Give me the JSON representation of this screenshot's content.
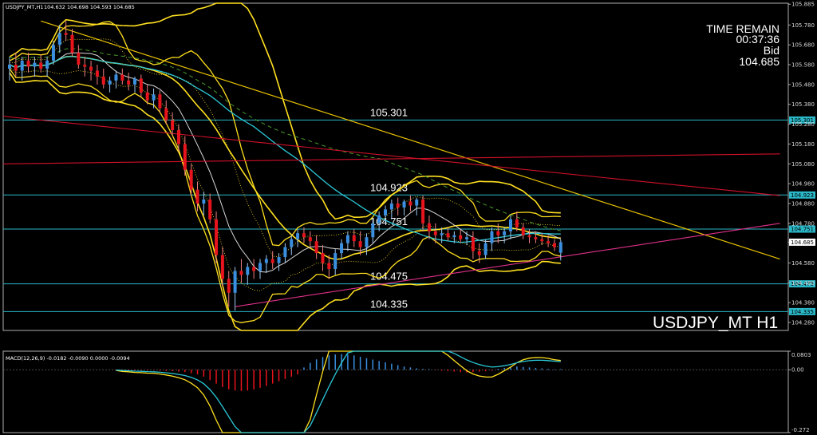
{
  "header": {
    "symbol_info": "USDJPY_MT,H1",
    "ohlc": "104.632 104.698 104.593 104.685"
  },
  "info_panel": {
    "time_remain_label": "TIME REMAIN",
    "time_remain": "00:37:36",
    "bid_label": "Bid",
    "bid": "104.685"
  },
  "symbol_watermark": "USDJPY_MT H1",
  "macd_header": "MACD(12,26,9) -0.0182 -0.0090 0.0000 -0.0094",
  "colors": {
    "background": "#000000",
    "bull": "#3b8fe0",
    "bear": "#e8141d",
    "bollinger": "#ffe020",
    "trendline_yellow": "#e8c200",
    "trendline_red": "#d0102a",
    "trendline_magenta": "#e0308a",
    "ma_cyan": "#2ac8d8",
    "ma_green_dashed": "#4a9a2a",
    "ma_white": "#d8d8d8",
    "level_line": "#2ab8c8"
  },
  "chart_data": [
    {
      "type": "candlestick",
      "title": "USDJPY_MT,H1",
      "y_axis_ticks": [
        "105.885",
        "105.780",
        "105.680",
        "105.580",
        "105.480",
        "105.380",
        "105.280",
        "105.180",
        "105.080",
        "104.980",
        "104.880",
        "104.780",
        "104.685",
        "104.580",
        "104.480",
        "104.380",
        "104.280"
      ],
      "ylim": [
        104.24,
        105.89
      ],
      "current_price": 104.685,
      "current_price_label": "104.685",
      "levels": [
        {
          "label": "105.301",
          "value": 105.301
        },
        {
          "label": "104.923",
          "value": 104.923
        },
        {
          "label": "104.751",
          "value": 104.751
        },
        {
          "label": "104.475",
          "value": 104.475
        },
        {
          "label": "104.335",
          "value": 104.335
        }
      ],
      "indicators": [
        "Bollinger Bands (yellow)",
        "Moving averages (cyan, white, green dashed)",
        "Trendlines (yellow, red, magenta)"
      ],
      "candles": [
        {
          "o": 105.56,
          "h": 105.62,
          "l": 105.5,
          "c": 105.58
        },
        {
          "o": 105.58,
          "h": 105.64,
          "l": 105.52,
          "c": 105.55
        },
        {
          "o": 105.55,
          "h": 105.62,
          "l": 105.5,
          "c": 105.6
        },
        {
          "o": 105.6,
          "h": 105.64,
          "l": 105.54,
          "c": 105.57
        },
        {
          "o": 105.57,
          "h": 105.62,
          "l": 105.52,
          "c": 105.59
        },
        {
          "o": 105.59,
          "h": 105.63,
          "l": 105.54,
          "c": 105.56
        },
        {
          "o": 105.56,
          "h": 105.62,
          "l": 105.52,
          "c": 105.6
        },
        {
          "o": 105.6,
          "h": 105.7,
          "l": 105.58,
          "c": 105.68
        },
        {
          "o": 105.68,
          "h": 105.78,
          "l": 105.64,
          "c": 105.74
        },
        {
          "o": 105.74,
          "h": 105.8,
          "l": 105.7,
          "c": 105.73
        },
        {
          "o": 105.73,
          "h": 105.76,
          "l": 105.62,
          "c": 105.64
        },
        {
          "o": 105.64,
          "h": 105.68,
          "l": 105.56,
          "c": 105.58
        },
        {
          "o": 105.58,
          "h": 105.62,
          "l": 105.52,
          "c": 105.57
        },
        {
          "o": 105.57,
          "h": 105.6,
          "l": 105.5,
          "c": 105.55
        },
        {
          "o": 105.55,
          "h": 105.58,
          "l": 105.48,
          "c": 105.52
        },
        {
          "o": 105.52,
          "h": 105.56,
          "l": 105.46,
          "c": 105.48
        },
        {
          "o": 105.48,
          "h": 105.52,
          "l": 105.44,
          "c": 105.5
        },
        {
          "o": 105.5,
          "h": 105.55,
          "l": 105.46,
          "c": 105.53
        },
        {
          "o": 105.53,
          "h": 105.56,
          "l": 105.48,
          "c": 105.5
        },
        {
          "o": 105.5,
          "h": 105.54,
          "l": 105.45,
          "c": 105.48
        },
        {
          "o": 105.48,
          "h": 105.52,
          "l": 105.44,
          "c": 105.51
        },
        {
          "o": 105.51,
          "h": 105.53,
          "l": 105.42,
          "c": 105.44
        },
        {
          "o": 105.44,
          "h": 105.48,
          "l": 105.38,
          "c": 105.4
        },
        {
          "o": 105.4,
          "h": 105.46,
          "l": 105.36,
          "c": 105.43
        },
        {
          "o": 105.43,
          "h": 105.45,
          "l": 105.34,
          "c": 105.36
        },
        {
          "o": 105.36,
          "h": 105.4,
          "l": 105.28,
          "c": 105.3
        },
        {
          "o": 105.3,
          "h": 105.34,
          "l": 105.22,
          "c": 105.25
        },
        {
          "o": 105.25,
          "h": 105.28,
          "l": 105.14,
          "c": 105.18
        },
        {
          "o": 105.18,
          "h": 105.22,
          "l": 105.02,
          "c": 105.05
        },
        {
          "o": 105.05,
          "h": 105.08,
          "l": 104.92,
          "c": 104.95
        },
        {
          "o": 104.95,
          "h": 104.99,
          "l": 104.84,
          "c": 104.88
        },
        {
          "o": 104.88,
          "h": 104.94,
          "l": 104.82,
          "c": 104.9
        },
        {
          "o": 104.9,
          "h": 104.93,
          "l": 104.78,
          "c": 104.8
        },
        {
          "o": 104.8,
          "h": 104.84,
          "l": 104.58,
          "c": 104.62
        },
        {
          "o": 104.62,
          "h": 104.66,
          "l": 104.46,
          "c": 104.5
        },
        {
          "o": 104.5,
          "h": 104.54,
          "l": 104.36,
          "c": 104.43
        },
        {
          "o": 104.43,
          "h": 104.56,
          "l": 104.34,
          "c": 104.54
        },
        {
          "o": 104.54,
          "h": 104.6,
          "l": 104.48,
          "c": 104.52
        },
        {
          "o": 104.52,
          "h": 104.58,
          "l": 104.47,
          "c": 104.56
        },
        {
          "o": 104.56,
          "h": 104.6,
          "l": 104.5,
          "c": 104.54
        },
        {
          "o": 104.54,
          "h": 104.6,
          "l": 104.5,
          "c": 104.58
        },
        {
          "o": 104.58,
          "h": 104.62,
          "l": 104.53,
          "c": 104.6
        },
        {
          "o": 104.6,
          "h": 104.64,
          "l": 104.55,
          "c": 104.58
        },
        {
          "o": 104.58,
          "h": 104.63,
          "l": 104.54,
          "c": 104.61
        },
        {
          "o": 104.61,
          "h": 104.68,
          "l": 104.58,
          "c": 104.66
        },
        {
          "o": 104.66,
          "h": 104.72,
          "l": 104.62,
          "c": 104.7
        },
        {
          "o": 104.7,
          "h": 104.75,
          "l": 104.66,
          "c": 104.73
        },
        {
          "o": 104.73,
          "h": 104.76,
          "l": 104.68,
          "c": 104.71
        },
        {
          "o": 104.71,
          "h": 104.74,
          "l": 104.66,
          "c": 104.69
        },
        {
          "o": 104.69,
          "h": 104.72,
          "l": 104.6,
          "c": 104.63
        },
        {
          "o": 104.63,
          "h": 104.67,
          "l": 104.54,
          "c": 104.58
        },
        {
          "o": 104.58,
          "h": 104.62,
          "l": 104.5,
          "c": 104.55
        },
        {
          "o": 104.55,
          "h": 104.65,
          "l": 104.52,
          "c": 104.63
        },
        {
          "o": 104.63,
          "h": 104.7,
          "l": 104.6,
          "c": 104.68
        },
        {
          "o": 104.68,
          "h": 104.74,
          "l": 104.64,
          "c": 104.72
        },
        {
          "o": 104.72,
          "h": 104.75,
          "l": 104.66,
          "c": 104.69
        },
        {
          "o": 104.69,
          "h": 104.74,
          "l": 104.62,
          "c": 104.66
        },
        {
          "o": 104.66,
          "h": 104.73,
          "l": 104.62,
          "c": 104.71
        },
        {
          "o": 104.71,
          "h": 104.8,
          "l": 104.68,
          "c": 104.78
        },
        {
          "o": 104.78,
          "h": 104.84,
          "l": 104.74,
          "c": 104.82
        },
        {
          "o": 104.82,
          "h": 104.87,
          "l": 104.78,
          "c": 104.85
        },
        {
          "o": 104.85,
          "h": 104.9,
          "l": 104.8,
          "c": 104.88
        },
        {
          "o": 104.88,
          "h": 104.91,
          "l": 104.82,
          "c": 104.86
        },
        {
          "o": 104.86,
          "h": 104.9,
          "l": 104.82,
          "c": 104.89
        },
        {
          "o": 104.89,
          "h": 104.92,
          "l": 104.84,
          "c": 104.87
        },
        {
          "o": 104.87,
          "h": 104.91,
          "l": 104.82,
          "c": 104.9
        },
        {
          "o": 104.9,
          "h": 104.92,
          "l": 104.74,
          "c": 104.78
        },
        {
          "o": 104.78,
          "h": 104.82,
          "l": 104.7,
          "c": 104.74
        },
        {
          "o": 104.74,
          "h": 104.78,
          "l": 104.68,
          "c": 104.72
        },
        {
          "o": 104.72,
          "h": 104.76,
          "l": 104.68,
          "c": 104.73
        },
        {
          "o": 104.73,
          "h": 104.76,
          "l": 104.69,
          "c": 104.71
        },
        {
          "o": 104.71,
          "h": 104.74,
          "l": 104.68,
          "c": 104.72
        },
        {
          "o": 104.72,
          "h": 104.75,
          "l": 104.68,
          "c": 104.7
        },
        {
          "o": 104.7,
          "h": 104.74,
          "l": 104.67,
          "c": 104.71
        },
        {
          "o": 104.71,
          "h": 104.74,
          "l": 104.6,
          "c": 104.64
        },
        {
          "o": 104.64,
          "h": 104.68,
          "l": 104.58,
          "c": 104.62
        },
        {
          "o": 104.62,
          "h": 104.7,
          "l": 104.6,
          "c": 104.68
        },
        {
          "o": 104.68,
          "h": 104.76,
          "l": 104.64,
          "c": 104.74
        },
        {
          "o": 104.74,
          "h": 104.78,
          "l": 104.68,
          "c": 104.72
        },
        {
          "o": 104.72,
          "h": 104.76,
          "l": 104.68,
          "c": 104.74
        },
        {
          "o": 104.74,
          "h": 104.82,
          "l": 104.7,
          "c": 104.8
        },
        {
          "o": 104.8,
          "h": 104.84,
          "l": 104.74,
          "c": 104.76
        },
        {
          "o": 104.76,
          "h": 104.78,
          "l": 104.7,
          "c": 104.72
        },
        {
          "o": 104.72,
          "h": 104.75,
          "l": 104.68,
          "c": 104.71
        },
        {
          "o": 104.71,
          "h": 104.74,
          "l": 104.68,
          "c": 104.7
        },
        {
          "o": 104.7,
          "h": 104.73,
          "l": 104.67,
          "c": 104.69
        },
        {
          "o": 104.69,
          "h": 104.72,
          "l": 104.66,
          "c": 104.68
        },
        {
          "o": 104.68,
          "h": 104.7,
          "l": 104.64,
          "c": 104.66
        },
        {
          "o": 104.632,
          "h": 104.698,
          "l": 104.593,
          "c": 104.685
        }
      ]
    },
    {
      "type": "bar",
      "title": "MACD(12,26,9) -0.0182 -0.0090 0.0000 -0.0094",
      "y_axis_ticks": [
        "0.0803",
        "0.00",
        "-0.272"
      ],
      "ylim": [
        -0.272,
        0.0803
      ],
      "macd_histogram": [
        -0.002,
        -0.003,
        -0.002,
        -0.003,
        -0.002,
        -0.003,
        -0.002,
        -0.004,
        -0.005,
        -0.006,
        -0.008,
        -0.01,
        -0.015,
        -0.02,
        -0.03,
        -0.045,
        -0.06,
        -0.075,
        -0.085,
        -0.09,
        -0.092,
        -0.09,
        -0.085,
        -0.078,
        -0.07,
        -0.06,
        -0.05,
        -0.04,
        -0.03,
        -0.02,
        0.01,
        0.03,
        0.045,
        0.055,
        0.062,
        0.066,
        0.068,
        0.066,
        0.062,
        0.056,
        0.05,
        0.044,
        0.038,
        0.032,
        0.026,
        0.02,
        0.014,
        0.01,
        0.006,
        0.004,
        0.003,
        -0.002,
        -0.004,
        -0.006,
        -0.008,
        -0.01,
        -0.012,
        -0.01,
        -0.008,
        -0.006,
        -0.004,
        0.004,
        0.008,
        0.01,
        0.014,
        0.012,
        0.01,
        0.008,
        0.006,
        0.004,
        0.002,
        0.003
      ]
    }
  ]
}
